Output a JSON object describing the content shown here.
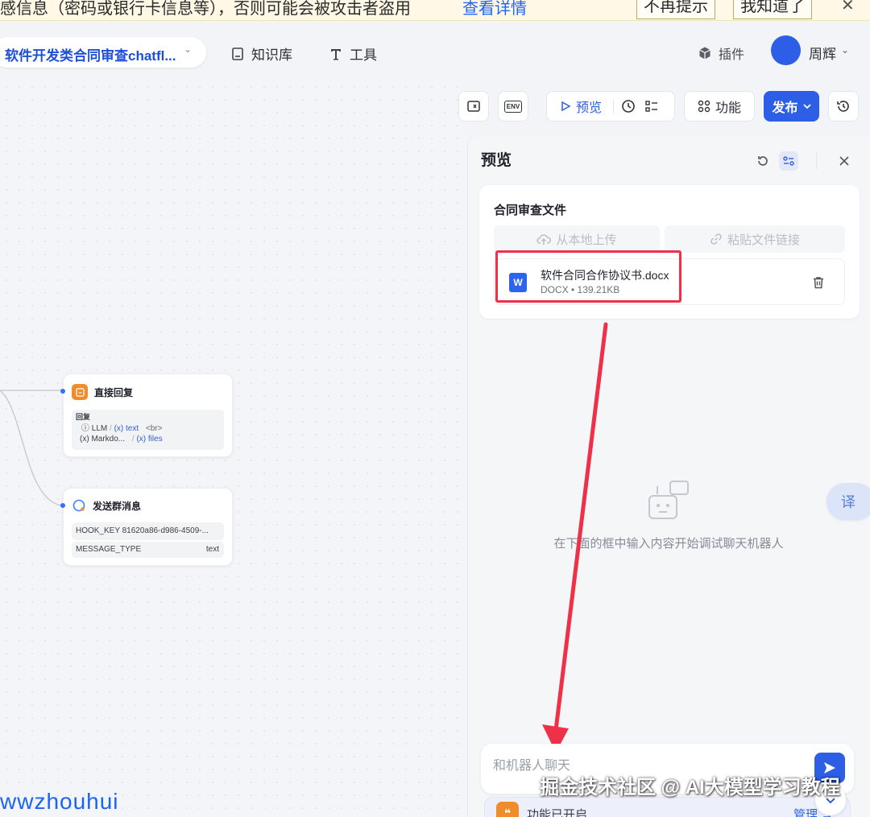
{
  "banner": {
    "text": "感信息（密码或银行卡信息等），否则可能会被攻击者盗用",
    "link": "查看详情",
    "dismiss_label": "不再提示",
    "ack_label": "我知道了",
    "close": "✕"
  },
  "header": {
    "app_title": "软件开发类合同审查chatfl...",
    "nav": {
      "knowledge": "知识库",
      "tools": "工具"
    },
    "plugin": "插件",
    "user_name": "周辉"
  },
  "toolbar": {
    "env_label": "ENV",
    "preview_label": "预览",
    "features_label": "功能",
    "publish_label": "发布"
  },
  "nodes": {
    "direct_reply": {
      "title": "直接回复",
      "section": "回复",
      "row1": {
        "llm": "LLM",
        "sep": "/",
        "var": "(x) text",
        "br": "<br>"
      },
      "row2": {
        "var1": "(x) Markdo...",
        "sep": "/",
        "var2": "(x) files"
      }
    },
    "group_msg": {
      "title": "发送群消息",
      "hook_key": "HOOK_KEY",
      "hook_value": "81620a86-d986-4509-...",
      "msg_type_key": "MESSAGE_TYPE",
      "msg_type_value": "text"
    }
  },
  "preview": {
    "title": "预览",
    "upload_label": "合同审查文件",
    "upload_local": "从本地上传",
    "paste_link": "粘贴文件链接",
    "file": {
      "icon_letter": "W",
      "name": "软件合同合作协议书.docx",
      "meta": "DOCX • 139.21KB"
    },
    "empty_text": "在下面的框中输入内容开始调试聊天机器人",
    "chat_placeholder": "和机器人聊天",
    "feature_text": "功能已开启",
    "feature_manage": "管理 →",
    "feature_icon": "❝"
  },
  "translate_label": "译",
  "watermark": "掘金技术社区 @ AI大模型学习教程",
  "corner_mark": "wwzhouhui",
  "colors": {
    "accent": "#2c5fe6",
    "highlight": "#ee3048",
    "node_orange": "#f08c2c"
  }
}
